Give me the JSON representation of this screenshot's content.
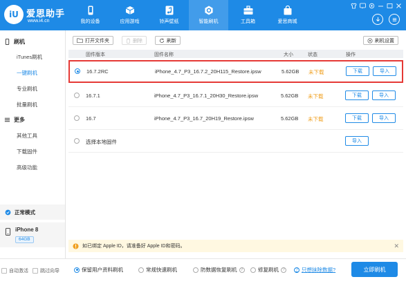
{
  "brand": {
    "logo_text": "iU",
    "name": "爱思助手",
    "url": "www.i4.cn"
  },
  "nav": [
    {
      "label": "我的设备",
      "icon": "phone-icon"
    },
    {
      "label": "应用游戏",
      "icon": "cube-icon"
    },
    {
      "label": "铃声壁纸",
      "icon": "music-icon"
    },
    {
      "label": "智能刷机",
      "icon": "gear-icon",
      "active": true
    },
    {
      "label": "工具箱",
      "icon": "toolbox-icon"
    },
    {
      "label": "爱思商城",
      "icon": "shopping-bag-icon"
    }
  ],
  "sidebar": {
    "flash_section": "刷机",
    "items": [
      "iTunes刷机",
      "一键刷机",
      "专业刷机",
      "批量刷机"
    ],
    "more_section": "更多",
    "more_items": [
      "其他工具",
      "下载固件",
      "高级功能"
    ],
    "mode": "正常模式",
    "device_name": "iPhone 8",
    "device_capacity": "64GB"
  },
  "toolbar": {
    "open_folder": "打开文件夹",
    "delete": "删除",
    "refresh": "刷新",
    "settings": "刷机设置"
  },
  "table": {
    "headers": {
      "version": "固件版本",
      "name": "固件名称",
      "size": "大小",
      "status": "状态",
      "action": "操作"
    },
    "rows": [
      {
        "version": "16.7.2RC",
        "name": "iPhone_4.7_P3_16.7.2_20H115_Restore.ipsw",
        "size": "5.62GB",
        "status": "未下载",
        "download": "下载",
        "import": "导入",
        "selected": true
      },
      {
        "version": "16.7.1",
        "name": "iPhone_4.7_P3_16.7.1_20H30_Restore.ipsw",
        "size": "5.62GB",
        "status": "未下载",
        "download": "下载",
        "import": "导入"
      },
      {
        "version": "16.7",
        "name": "iPhone_4.7_P3_16.7_20H19_Restore.ipsw",
        "size": "5.62GB",
        "status": "未下载",
        "download": "下载",
        "import": "导入"
      }
    ],
    "local_row": {
      "label": "选择本地固件",
      "import": "导入"
    }
  },
  "notice": "如已绑定 Apple ID，请准备好 Apple ID和密码。",
  "bottom": {
    "auto_activate": "自动激活",
    "skip_guide": "跳过向导",
    "options": [
      "保留用户资料刷机",
      "常规快速刷机",
      "防数据恢复刷机",
      "修复刷机"
    ],
    "erase_link": "只想抹除数据?",
    "flash_button": "立即刷机"
  },
  "colors": {
    "accent": "#1e8ae6",
    "warning": "#f0a020",
    "highlight_border": "#e53935"
  }
}
